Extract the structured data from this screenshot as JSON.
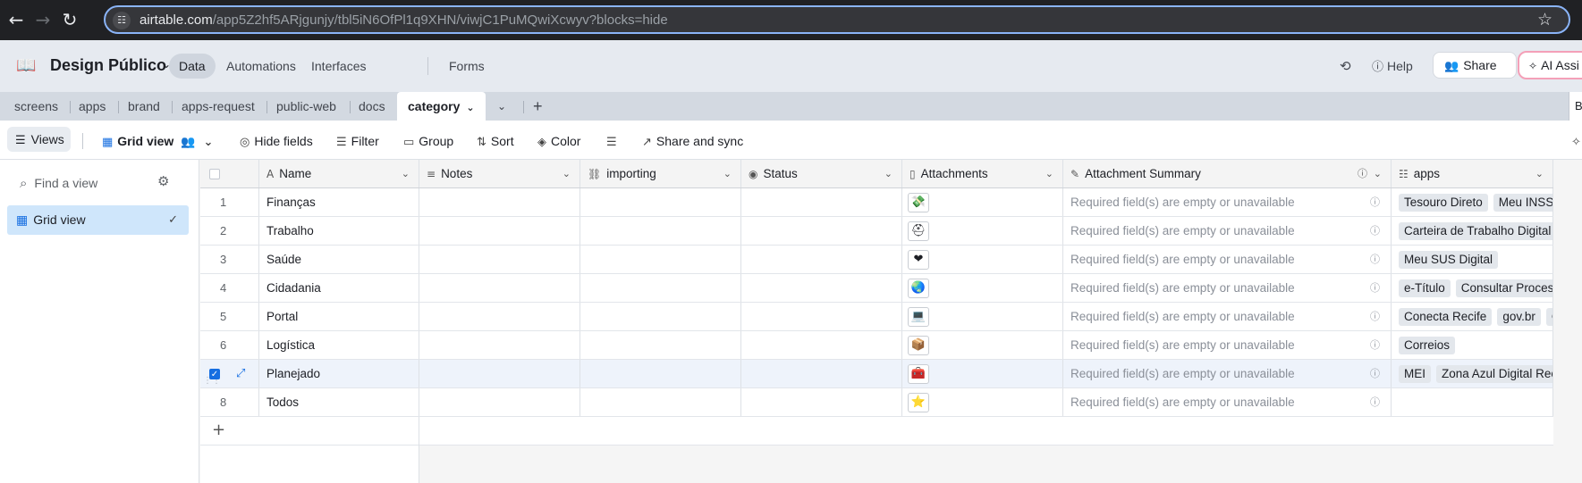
{
  "browser": {
    "url_host": "airtable.com",
    "url_path": "/app5Z2hf5ARjgunjy/tbl5iN6OfPl1q9XHN/viwjC1PuMQwiXcwyv?blocks=hide"
  },
  "header": {
    "base_name": "Design Público",
    "nav": [
      "Data",
      "Automations",
      "Interfaces",
      "Forms"
    ],
    "help": "Help",
    "share": "Share",
    "ai": "AI Assi"
  },
  "tabs": [
    "screens",
    "apps",
    "brand",
    "apps-request",
    "public-web",
    "docs",
    "category"
  ],
  "tabs_right": "B",
  "toolbar": {
    "views": "Views",
    "view_name": "Grid view",
    "hide_fields": "Hide fields",
    "filter": "Filter",
    "group": "Group",
    "sort": "Sort",
    "color": "Color",
    "share_sync": "Share and sync"
  },
  "sidebar": {
    "find_placeholder": "Find a view",
    "grid_view": "Grid view"
  },
  "columns": [
    "Name",
    "Notes",
    "importing",
    "Status",
    "Attachments",
    "Attachment Summary",
    "apps"
  ],
  "rows": [
    {
      "num": "1",
      "name": "Finanças",
      "icon": "💸",
      "summary": "Required field(s) are empty or unavailable",
      "apps": [
        "Tesouro Direto",
        "Meu INSS"
      ]
    },
    {
      "num": "2",
      "name": "Trabalho",
      "icon": "⛑",
      "summary": "Required field(s) are empty or unavailable",
      "apps": [
        "Carteira de Trabalho Digital"
      ]
    },
    {
      "num": "3",
      "name": "Saúde",
      "icon": "❤",
      "summary": "Required field(s) are empty or unavailable",
      "apps": [
        "Meu SUS Digital"
      ]
    },
    {
      "num": "4",
      "name": "Cidadania",
      "icon": "🌏",
      "summary": "Required field(s) are empty or unavailable",
      "apps": [
        "e-Título",
        "Consultar Processo"
      ]
    },
    {
      "num": "5",
      "name": "Portal",
      "icon": "💻",
      "summary": "Required field(s) are empty or unavailable",
      "apps": [
        "Conecta Recife",
        "gov.br",
        "Ca"
      ]
    },
    {
      "num": "6",
      "name": "Logística",
      "icon": "📦",
      "summary": "Required field(s) are empty or unavailable",
      "apps": [
        "Correios"
      ]
    },
    {
      "num": "",
      "name": "Planejado",
      "icon": "🧰",
      "summary": "Required field(s) are empty or unavailable",
      "apps": [
        "MEI",
        "Zona Azul Digital Recife"
      ]
    },
    {
      "num": "8",
      "name": "Todos",
      "icon": "⭐",
      "summary": "Required field(s) are empty or unavailable",
      "apps": []
    }
  ]
}
